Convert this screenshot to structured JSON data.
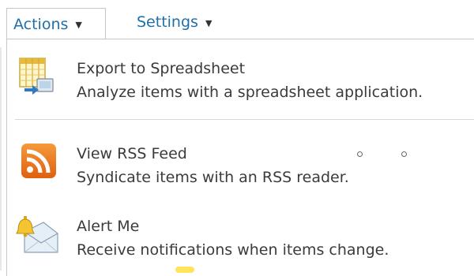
{
  "toolbar": {
    "actions_label": "Actions",
    "settings_label": "Settings"
  },
  "menu": {
    "items": [
      {
        "title": "Export to Spreadsheet",
        "description": "Analyze items with a spreadsheet application.",
        "icon": "spreadsheet-export-icon"
      },
      {
        "title": "View RSS Feed",
        "description": "Syndicate items with an RSS reader.",
        "icon": "rss-icon"
      },
      {
        "title": "Alert Me",
        "description": "Receive notifications when items change.",
        "icon": "alert-bell-icon"
      }
    ]
  },
  "colors": {
    "link_blue": "#1f6fa8",
    "rss_orange": "#f07b1d",
    "text": "#3b3b3b"
  }
}
